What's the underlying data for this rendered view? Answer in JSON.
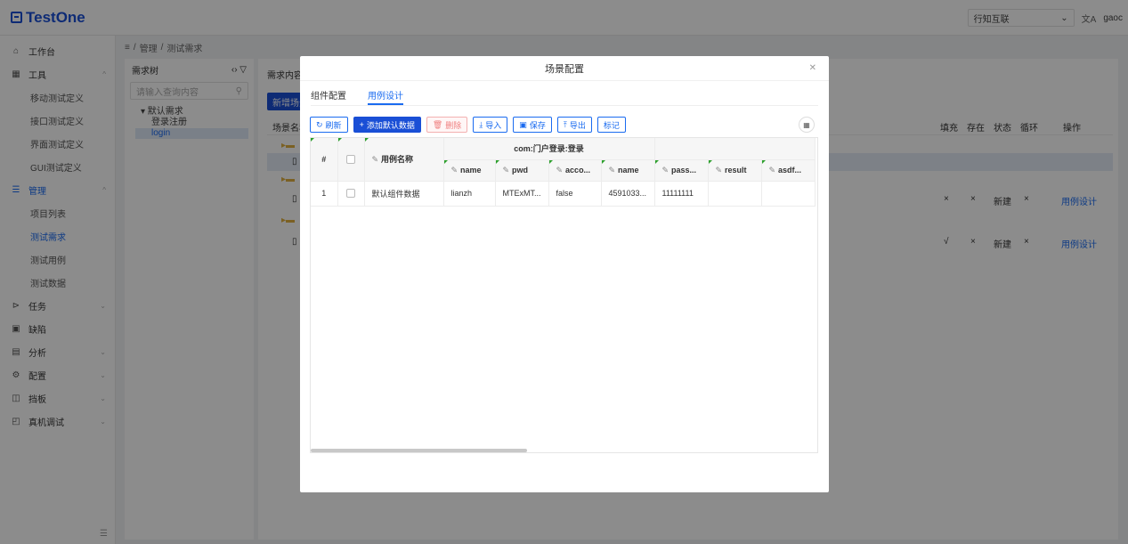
{
  "header": {
    "app_name": "TestOne",
    "org_select": "行知互联",
    "translate_icon": "translate-icon",
    "user": "gaoc"
  },
  "sidebar": {
    "items": [
      {
        "label": "工作台",
        "icon": "home-icon"
      },
      {
        "label": "工具",
        "icon": "apps-icon"
      },
      {
        "label": "移动测试定义"
      },
      {
        "label": "接口测试定义"
      },
      {
        "label": "界面测试定义"
      },
      {
        "label": "GUI测试定义"
      },
      {
        "label": "管理",
        "icon": "list-icon"
      },
      {
        "label": "项目列表"
      },
      {
        "label": "测试需求"
      },
      {
        "label": "测试用例"
      },
      {
        "label": "测试数据"
      },
      {
        "label": "任务",
        "icon": "play-icon"
      },
      {
        "label": "缺陷",
        "icon": "bug-icon"
      },
      {
        "label": "分析",
        "icon": "chart-icon"
      },
      {
        "label": "配置",
        "icon": "gear-icon"
      },
      {
        "label": "挡板",
        "icon": "board-icon"
      },
      {
        "label": "真机调试",
        "icon": "device-icon"
      }
    ]
  },
  "breadcrumb": {
    "root": "≡",
    "sep": "/",
    "level1": "管理",
    "level2": "测试需求"
  },
  "tree": {
    "title": "需求树",
    "search_placeholder": "请输入查询内容",
    "root": "▾ 默认需求",
    "child1": "登录注册",
    "child2": "login"
  },
  "content": {
    "title": "需求内容",
    "new_button": "新增场景",
    "col_name": "场景名称",
    "col_fill": "填充",
    "col_exist": "存在",
    "col_status": "状态",
    "col_loop": "循环",
    "col_op": "操作",
    "rows": [
      {
        "fill": "×",
        "exist": "×",
        "status": "新建",
        "loop": "×",
        "op": "用例设计"
      },
      {
        "fill": "√",
        "exist": "×",
        "status": "新建",
        "loop": "×",
        "op": "用例设计"
      }
    ]
  },
  "modal": {
    "title": "场景配置",
    "tabs": [
      "组件配置",
      "用例设计"
    ],
    "toolbar": {
      "refresh": "刷新",
      "add_default": "添加默认数据",
      "delete": "删除",
      "import": "导入",
      "save": "保存",
      "export": "导出",
      "mark": "标记"
    },
    "table": {
      "col_index": "#",
      "col_case_name": "用例名称",
      "group_title": "com:门户登录:登录",
      "columns": [
        "name",
        "pwd",
        "acco...",
        "name",
        "pass...",
        "result",
        "asdf..."
      ],
      "rows": [
        {
          "index": "1",
          "case_name": "默认组件数据",
          "values": [
            "lianzh",
            "MTExMT...",
            "false",
            "4591033...",
            "11111111",
            "",
            ""
          ]
        }
      ]
    }
  }
}
